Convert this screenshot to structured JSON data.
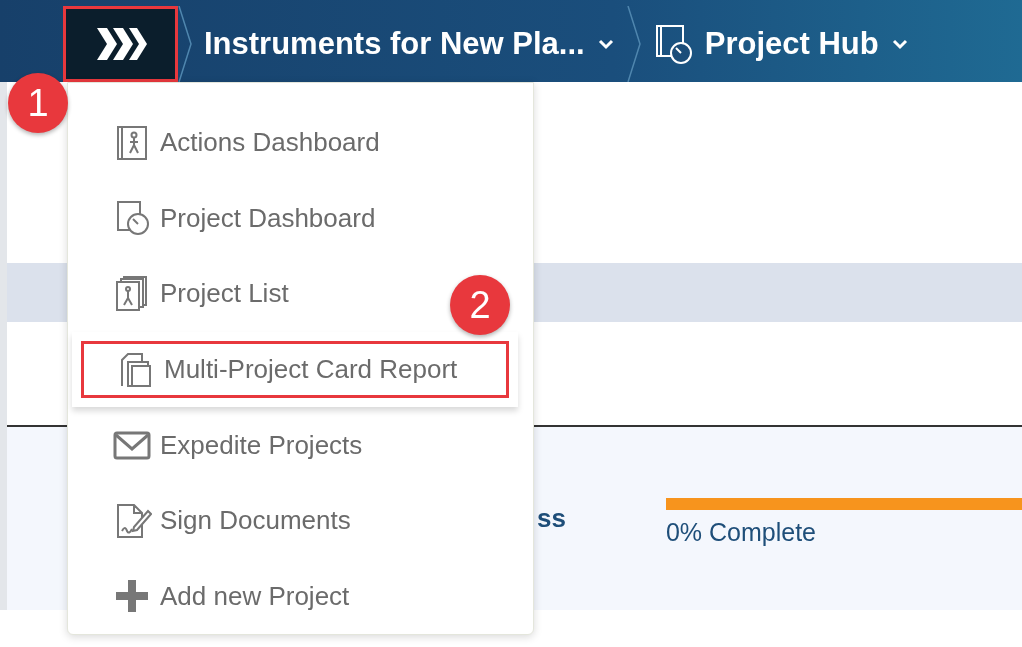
{
  "top_bar": {
    "logo": {
      "highlighted": true
    },
    "breadcrumbs": [
      {
        "label": "Instruments for New Pla...",
        "kind": "project"
      },
      {
        "label": "Project Hub",
        "kind": "hub"
      }
    ]
  },
  "menu": {
    "items": [
      {
        "label": "Actions Dashboard",
        "kind": "actions",
        "highlighted": false
      },
      {
        "label": "Project Dashboard",
        "kind": "dashboard",
        "highlighted": false
      },
      {
        "label": "Project List",
        "kind": "list",
        "highlighted": false
      },
      {
        "label": "Multi-Project Card Report",
        "kind": "cards",
        "highlighted": true
      },
      {
        "label": "Expedite Projects",
        "kind": "mail",
        "highlighted": false
      },
      {
        "label": "Sign Documents",
        "kind": "sign",
        "highlighted": false
      },
      {
        "label": "Add new Project",
        "kind": "add",
        "highlighted": false
      }
    ]
  },
  "content": {
    "row_title": "ss",
    "progress": {
      "level": 0,
      "reading": "0% Complete"
    }
  },
  "annotations": [
    {
      "label": "1"
    },
    {
      "label": "2"
    }
  ]
}
